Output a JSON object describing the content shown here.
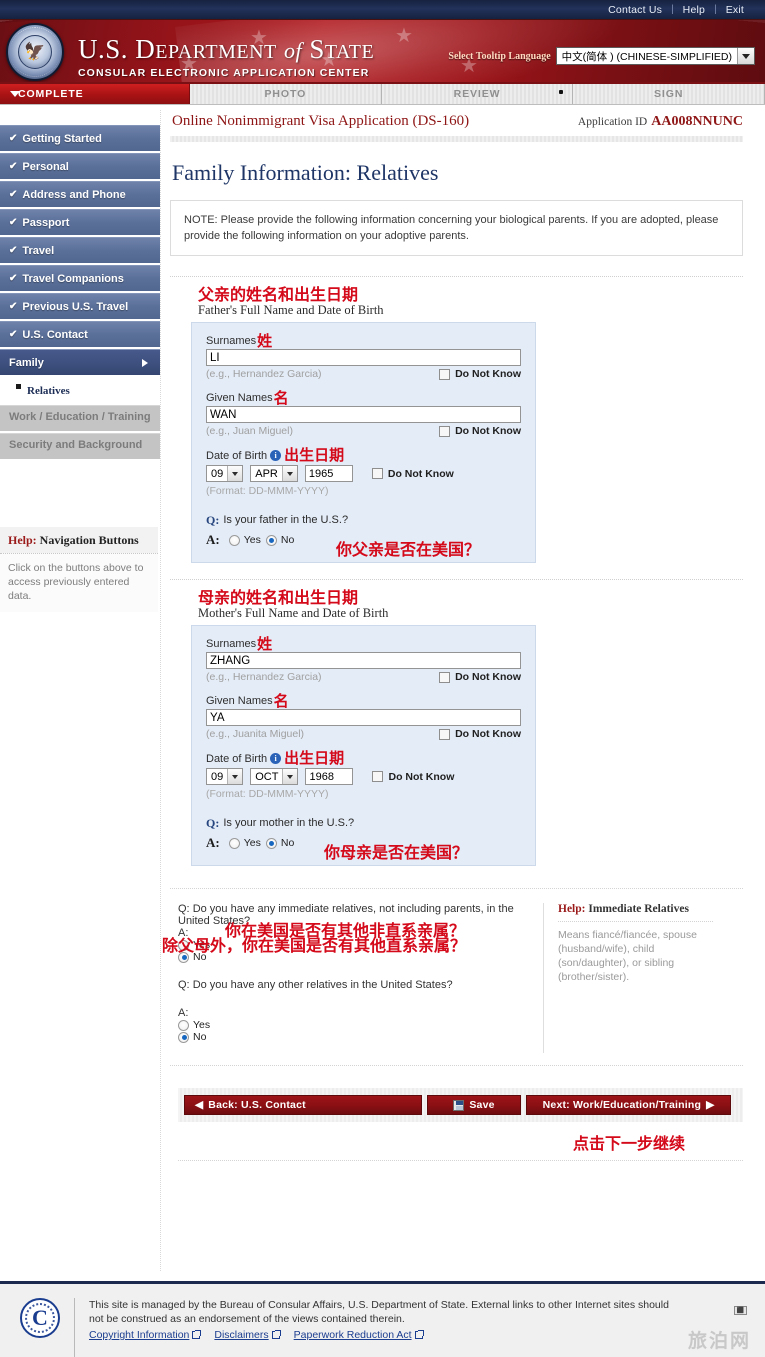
{
  "topbar": {
    "links": [
      "Contact Us",
      "Help",
      "Exit"
    ]
  },
  "banner": {
    "line1_a": "U.S. D",
    "line1_b": "EPARTMENT",
    "line1_c": "of",
    "line1_d": "S",
    "line1_e": "TATE",
    "line2": "CONSULAR ELECTRONIC APPLICATION CENTER",
    "tooltip_label": "Select Tooltip Language",
    "tooltip_value": "中文(简体 ) (CHINESE-SIMPLIFIED)"
  },
  "tabs": [
    {
      "label": "COMPLETE",
      "active": true
    },
    {
      "label": "PHOTO",
      "active": false
    },
    {
      "label": "REVIEW",
      "active": false
    },
    {
      "label": "SIGN",
      "active": false
    }
  ],
  "sidebar": {
    "items": [
      {
        "label": "Getting Started",
        "check": "✔"
      },
      {
        "label": "Personal",
        "check": "✔"
      },
      {
        "label": "Address and Phone",
        "check": "✔"
      },
      {
        "label": "Passport",
        "check": "✔"
      },
      {
        "label": "Travel",
        "check": "✔"
      },
      {
        "label": "Travel Companions",
        "check": "✔"
      },
      {
        "label": "Previous U.S. Travel",
        "check": "✔"
      },
      {
        "label": "U.S. Contact",
        "check": "✔"
      }
    ],
    "current": "Family",
    "sub_item": "Relatives",
    "disabled": [
      "Work / Education / Training",
      "Security and Background"
    ],
    "help": {
      "title_red": "Help:",
      "title_dark": " Navigation Buttons",
      "body": "Click on the buttons above to access previously entered data."
    }
  },
  "header": {
    "app_title": "Online Nonimmigrant Visa Application (DS-160)",
    "appid_label": "Application ID",
    "appid_value": "AA008NNUNC"
  },
  "page_title": "Family Information: Relatives",
  "note": "NOTE: Please provide the following information concerning your biological parents. If you are adopted, please provide the following information on your adoptive parents.",
  "father": {
    "cn_heading": "父亲的姓名和出生日期",
    "en_heading": "Father's Full Name and Date of Birth",
    "surname_label": "Surnames",
    "surname_cn": "姓",
    "surname_value": "LI",
    "surname_hint": "(e.g., Hernandez Garcia)",
    "given_label": "Given Names",
    "given_cn": "名",
    "given_value": "WAN",
    "given_hint": "(e.g., Juan Miguel)",
    "dnk_label": "Do Not Know",
    "dob_label": "Date of Birth",
    "dob_cn": "出生日期",
    "dob_day": "09",
    "dob_month": "APR",
    "dob_year": "1965",
    "dob_format": "(Format: DD-MMM-YYYY)",
    "question": "Is your father in the U.S.?",
    "question_cn": "你父亲是否在美国？",
    "yes": "Yes",
    "no": "No",
    "answer": "No"
  },
  "mother": {
    "cn_heading": "母亲的姓名和出生日期",
    "en_heading": "Mother's Full Name and Date of Birth",
    "surname_label": "Surnames",
    "surname_cn": "姓",
    "surname_value": "ZHANG",
    "surname_hint": "(e.g., Hernandez Garcia)",
    "given_label": "Given Names",
    "given_cn": "名",
    "given_value": "YA",
    "given_hint": "(e.g., Juanita Miguel)",
    "dnk_label": "Do Not Know",
    "dob_label": "Date of Birth",
    "dob_cn": "出生日期",
    "dob_day": "09",
    "dob_month": "OCT",
    "dob_year": "1968",
    "dob_format": "(Format: DD-MMM-YYYY)",
    "question": "Is your mother in the U.S.?",
    "question_cn": "你母亲是否在美国？",
    "yes": "Yes",
    "no": "No",
    "answer": "No"
  },
  "bottom_questions": {
    "q1": "Do you have any immediate relatives, not including parents, in the United States?",
    "q1_cn": "除父母外，你在美国是否有其他直系亲属？",
    "q1_answer": "No",
    "q2": "Do you have any other relatives in the United States?",
    "q2_cn": "你在美国是否有其他非直系亲属？",
    "q2_answer": "No",
    "yes": "Yes",
    "no": "No",
    "help_title_red": "Help:",
    "help_title_dark": " Immediate Relatives",
    "help_body": "Means fiancé/fiancée, spouse (husband/wife), child (son/daughter), or sibling (brother/sister)."
  },
  "actions": {
    "back": "Back: U.S. Contact",
    "save": "Save",
    "next": "Next: Work/Education/Training",
    "next_cn": "点击下一步继续"
  },
  "footer": {
    "text": "This site is managed by the Bureau of Consular Affairs, U.S. Department of State. External links to other Internet sites should not be construed as an endorsement of the views contained therein.",
    "links": [
      "Copyright Information",
      "Disclaimers",
      "Paperwork Reduction Act"
    ],
    "watermark": "旅泊网"
  },
  "colors": {
    "brand_red": "#a81315",
    "nav_blue": "#5b7099",
    "accent_cn_red": "#d4091a",
    "panel_blue": "#e4ecf7",
    "dark_navy": "#1b2a4e"
  }
}
